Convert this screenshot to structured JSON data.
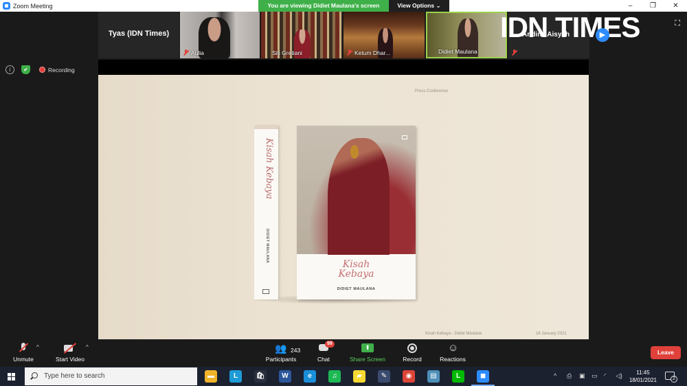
{
  "window": {
    "title": "Zoom Meeting",
    "controls": {
      "minimize": "–",
      "restore": "❐",
      "close": "✕"
    }
  },
  "banner": {
    "viewing_text": "You are viewing Didiet Maulana's screen",
    "view_options": "View Options ⌄"
  },
  "participants_strip": {
    "self": {
      "name": "Tyas (IDN Times)"
    },
    "tiles": [
      {
        "name": "Aulia"
      },
      {
        "name": "Siti Gretiani"
      },
      {
        "name": "Ketum Dhar..."
      },
      {
        "name": "Didiet Maulana"
      },
      {
        "name": "Andina Aisyah"
      }
    ]
  },
  "overlay": {
    "logo": "IDN TIMES",
    "next_icon": "arrow-right-icon",
    "expand": "⛶"
  },
  "status": {
    "recording_label": "Recording",
    "info": "i",
    "shield": "✔"
  },
  "shared_screen": {
    "press_label": "Press Conference",
    "book_spine_title": "Kisah Kebaya",
    "book_spine_author": "DIDIET MAULANA",
    "book_cover_title_1": "Kisah",
    "book_cover_title_2": "Kebaya",
    "book_cover_author": "DIDIET MAULANA",
    "footer_left": "Kisah Kebaya - Didiet Maulana",
    "footer_right": "18 January 2021"
  },
  "toolbar": {
    "unmute": "Unmute",
    "start_video": "Start Video",
    "participants": "Participants",
    "participants_count": "243",
    "chat": "Chat",
    "chat_badge": "99",
    "share_screen": "Share Screen",
    "record": "Record",
    "reactions": "Reactions",
    "leave": "Leave",
    "chevron": "^"
  },
  "taskbar": {
    "search_placeholder": "Type here to search",
    "apps": [
      {
        "icon": "file-explorer-icon",
        "glyph": "▬",
        "color": "#f0b429"
      },
      {
        "icon": "l-app-icon",
        "glyph": "L",
        "color": "#1e9bd7"
      },
      {
        "icon": "store-icon",
        "glyph": "🛍",
        "color": "#2a2f3e"
      },
      {
        "icon": "word-icon",
        "glyph": "W",
        "color": "#2b579a"
      },
      {
        "icon": "edge-icon",
        "glyph": "e",
        "color": "#1a8fd8"
      },
      {
        "icon": "spotify-icon",
        "glyph": "♫",
        "color": "#1db954"
      },
      {
        "icon": "sticky-notes-icon",
        "glyph": "▰",
        "color": "#f7d931"
      },
      {
        "icon": "paint-icon",
        "glyph": "✎",
        "color": "#3a4b6e"
      },
      {
        "icon": "chrome-icon",
        "glyph": "◉",
        "color": "#db4437"
      },
      {
        "icon": "notepad-icon",
        "glyph": "▤",
        "color": "#4d8fb8"
      },
      {
        "icon": "line-icon",
        "glyph": "L",
        "color": "#00b900"
      },
      {
        "icon": "zoom-icon",
        "glyph": "◼",
        "color": "#2d8cff"
      }
    ],
    "tray": {
      "chevron": "^",
      "time": "11:45",
      "date": "18/01/2021",
      "notifications": "2"
    }
  }
}
